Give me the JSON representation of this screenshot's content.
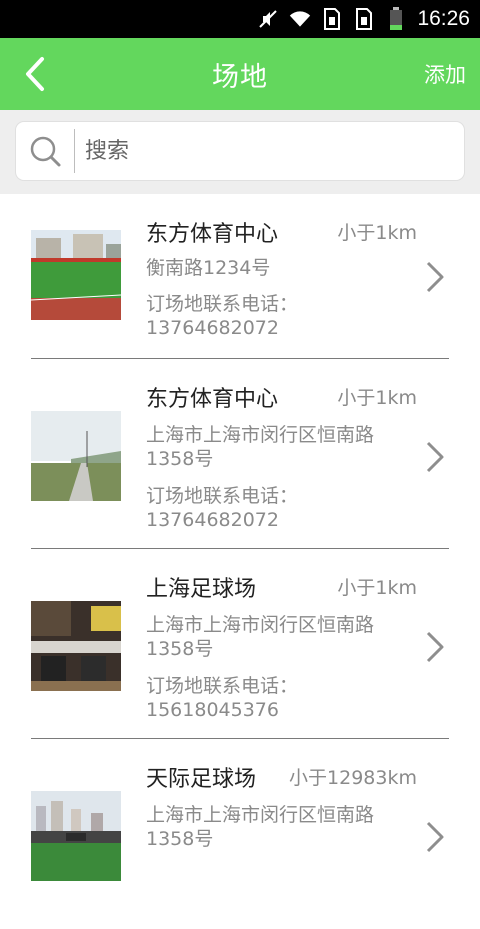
{
  "status_bar": {
    "time": "16:26"
  },
  "header": {
    "title": "场地",
    "add_label": "添加"
  },
  "search": {
    "placeholder": "搜索"
  },
  "venues": [
    {
      "name": "东方体育中心",
      "distance": "小于1km",
      "address": "衡南路1234号",
      "phone": "订场地联系电话：13764682072"
    },
    {
      "name": "东方体育中心",
      "distance": "小于1km",
      "address": "上海市上海市闵行区恒南路1358号",
      "phone": "订场地联系电话：13764682072"
    },
    {
      "name": "上海足球场",
      "distance": "小于1km",
      "address": "上海市上海市闵行区恒南路1358号",
      "phone": "订场地联系电话：15618045376"
    },
    {
      "name": "天际足球场",
      "distance": "小于12983km",
      "address": "上海市上海市闵行区恒南路1358号",
      "phone": ""
    }
  ],
  "colors": {
    "header_green": "#63d75d",
    "text_gray": "#8a8a8a"
  }
}
